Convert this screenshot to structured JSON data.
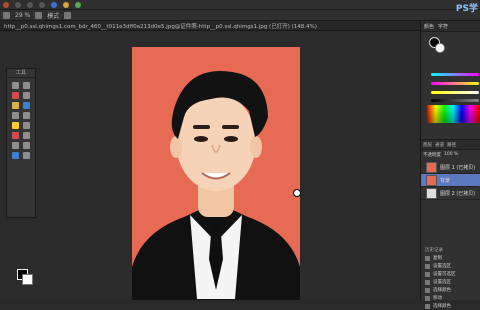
{
  "app": {
    "watermark": "PS学"
  },
  "toolbar": {
    "zoom": "29 %",
    "mode": "模式"
  },
  "document": {
    "tab_title": "http__p0.ssl.qhimgs1.com_bdr_460__t011e3dff0a213d0e5.jpg@证件照-http__p0.ssl.qhimgs1.jpg (已打开) (148.4%)"
  },
  "toolbox": {
    "title": "工具"
  },
  "colors": {
    "background": "#e76a55",
    "selected_layer": "#5a79bf"
  },
  "panels": {
    "top_tabs": [
      "颜色",
      "字符"
    ],
    "layer_tabs": [
      "图层",
      "通道",
      "路径"
    ],
    "opacity_label": "不透明度",
    "opacity_value": "100 %",
    "layers": [
      {
        "name": "图层 1 (已拷贝)",
        "selected": false
      },
      {
        "name": "背景",
        "selected": true
      },
      {
        "name": "图层 2 (已拷贝)",
        "selected": false
      }
    ],
    "history_title": "历史记录",
    "history": [
      "复制",
      "设置选区",
      "设置可选区",
      "设置选区",
      "选择颜色",
      "移动",
      "选择颜色"
    ]
  }
}
